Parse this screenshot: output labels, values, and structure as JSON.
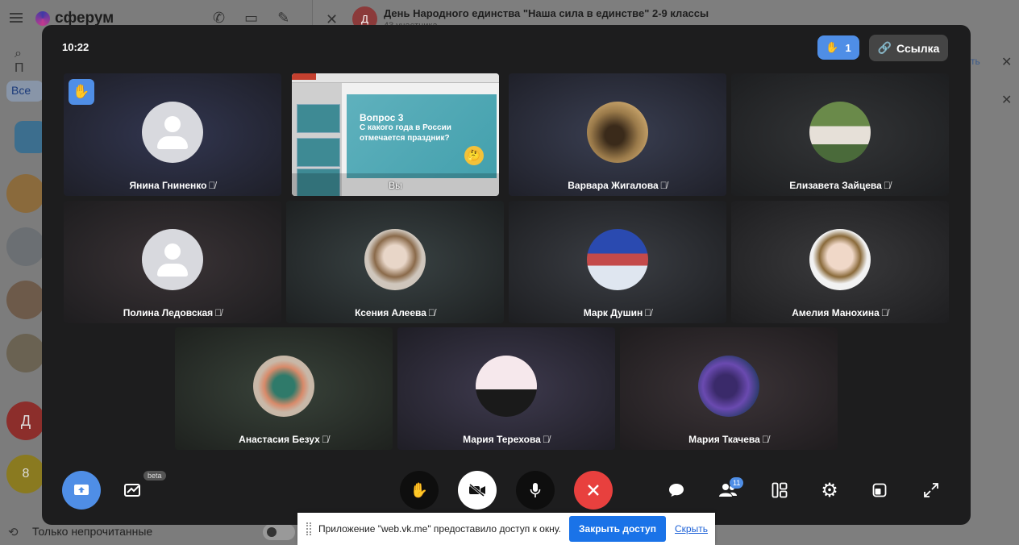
{
  "background_app": {
    "logo_text": "сферум",
    "chat_title": "День Народного единства \"Наша сила в единстве\" 2-9 классы",
    "chat_subtitle": "43 участника",
    "chat_avatar_letter": "Д",
    "search_placeholder": "П",
    "filter_label": "Все",
    "unread_filter_label": "Только непрочитанные",
    "side_link_text": "ть",
    "badge_count_8": "8",
    "avatar_letter_d": "Д"
  },
  "call": {
    "time": "10:22",
    "raised_hands_count": "1",
    "link_button_label": "Ссылка",
    "participants": [
      {
        "name": "Янина Гниненко",
        "muted": true,
        "hand_raised": true
      },
      {
        "name": "Вы",
        "screen_share": true
      },
      {
        "name": "Варвара Жигалова",
        "muted": true
      },
      {
        "name": "Елизавета Зайцева",
        "muted": true
      },
      {
        "name": "Полина Ледовская",
        "muted": true
      },
      {
        "name": "Ксения Алеева",
        "muted": true
      },
      {
        "name": "Марк Душин",
        "muted": true
      },
      {
        "name": "Амелия Манохина",
        "muted": true
      },
      {
        "name": "Анастасия Безух",
        "muted": true
      },
      {
        "name": "Мария Терехова",
        "muted": true
      },
      {
        "name": "Мария Ткачева",
        "muted": true
      }
    ],
    "shared_slide": {
      "title": "Вопрос 3",
      "question": "С какого года в России отмечается праздник?"
    },
    "controls": {
      "beta_label": "beta",
      "participants_count": "11"
    }
  },
  "browser_notice": {
    "message": "Приложение \"web.vk.me\" предоставило доступ к окну.",
    "stop_button_label": "Закрыть доступ",
    "hide_link_label": "Скрыть"
  },
  "colors": {
    "accent": "#4f8ee6",
    "end_call": "#e8403e",
    "call_bg": "#1d1d1e",
    "notice_button": "#1a73e8"
  }
}
